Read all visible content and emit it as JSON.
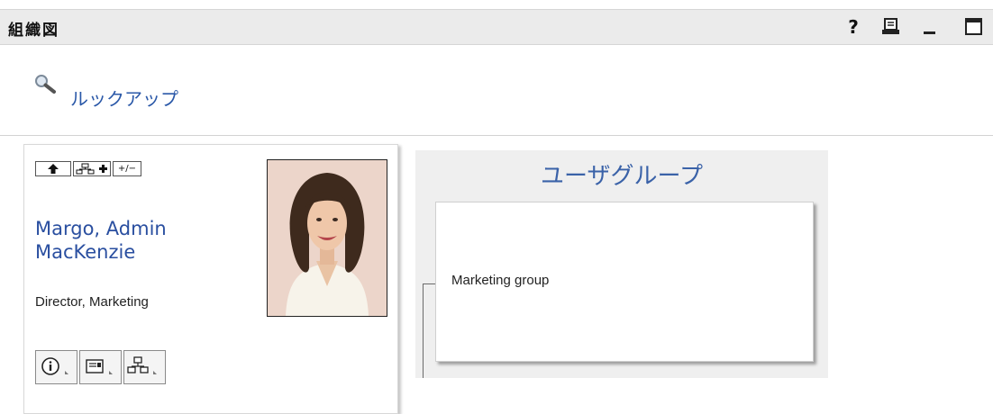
{
  "header": {
    "title": "組織図",
    "icons": [
      "help-icon",
      "print-icon",
      "minimize-icon",
      "maximize-icon"
    ],
    "help_label": "?"
  },
  "lookup": {
    "label": "ルックアップ",
    "icon": "magnifier-icon"
  },
  "person": {
    "name_line1": "Margo, Admin",
    "name_line2": "MacKenzie",
    "title": "Director, Marketing",
    "nav_buttons": [
      "up-arrow-icon",
      "org-tree-add-icon",
      "expand-collapse-icon"
    ],
    "expand_label": "+/−",
    "actions": [
      "info-icon",
      "vcard-icon",
      "org-chart-icon"
    ]
  },
  "groups": {
    "title": "ユーザグループ",
    "items": [
      {
        "label": "Marketing group"
      }
    ]
  },
  "colors": {
    "link": "#2a58a8",
    "name": "#2a4fa0",
    "header_bg": "#ebebeb",
    "panel_bg": "#efefef"
  }
}
